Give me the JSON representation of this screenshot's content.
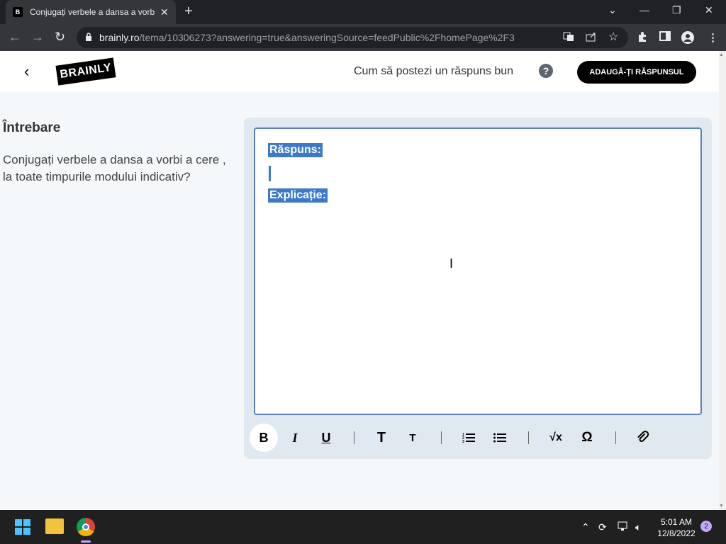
{
  "browser": {
    "tab_title": "Conjugați verbele a dansa a vorbi a cere",
    "favicon_letter": "B",
    "tab_close": "✕",
    "new_tab": "+",
    "url_host": "brainly.ro",
    "url_path": "/tema/10306273?answering=true&answeringSource=feedPublic%2FhomePage%2F3",
    "window_controls": {
      "dropdown": "⌄",
      "minimize": "—",
      "restore": "❐",
      "close": "✕"
    },
    "nav": {
      "back": "←",
      "forward": "→",
      "reload": "↻"
    }
  },
  "header": {
    "back": "‹",
    "logo_text": "BRAINLY",
    "howto_text": "Cum să postezi un răspuns bun",
    "help_icon": "?",
    "add_answer_label": "ADAUGĂ-ȚI RĂSPUNSUL"
  },
  "question": {
    "label": "Întrebare",
    "text": "Conjugați verbele a dansa a vorbi a cere , la toate timpurile modului indicativ?"
  },
  "editor": {
    "line_answer": "Răspuns:",
    "line_explanation": "Explicație:"
  },
  "format_toolbar": {
    "bold": "B",
    "italic": "I",
    "underline": "U",
    "heading_large": "T",
    "heading_small": "T",
    "ordered_list": "☰",
    "bullet_list": "☰",
    "sqrt": "√x",
    "omega": "Ω",
    "attach": "🔗"
  },
  "taskbar": {
    "time": "5:01 AM",
    "date": "12/8/2022",
    "notification_count": "2"
  },
  "colors": {
    "brand_black": "#000000",
    "selection_blue": "#3d79c9",
    "editor_border": "#5c7fc3",
    "toolbar_bg": "#e1e9f0"
  }
}
